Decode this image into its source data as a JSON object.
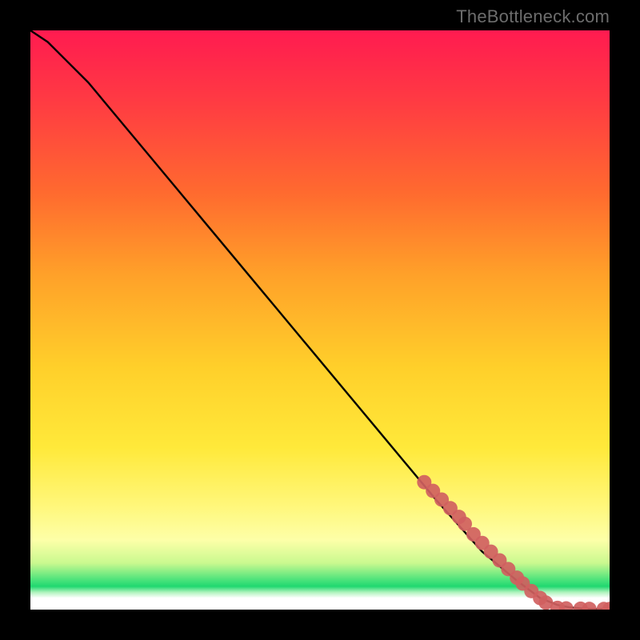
{
  "attribution": "TheBottleneck.com",
  "chart_data": {
    "type": "line",
    "title": "",
    "xlabel": "",
    "ylabel": "",
    "xlim": [
      0,
      100
    ],
    "ylim": [
      0,
      100
    ],
    "grid": false,
    "legend": false,
    "series": [
      {
        "name": "curve",
        "x": [
          0,
          3,
          6,
          10,
          15,
          20,
          30,
          40,
          50,
          60,
          70,
          78,
          84,
          88,
          91,
          93,
          95,
          97,
          100
        ],
        "y": [
          100,
          98,
          95,
          91,
          85,
          79,
          67,
          55,
          43,
          31,
          19,
          10,
          5,
          2,
          0.8,
          0.4,
          0.2,
          0.1,
          0.1
        ],
        "color": "#000000",
        "linewidth": 2.4
      }
    ],
    "markers": [
      {
        "name": "datapoints-on-curve",
        "color": "#d06060",
        "radius": 9,
        "points": [
          {
            "x": 68.0,
            "y": 22.0
          },
          {
            "x": 69.5,
            "y": 20.5
          },
          {
            "x": 71.0,
            "y": 19.0
          },
          {
            "x": 72.5,
            "y": 17.5
          },
          {
            "x": 74.0,
            "y": 16.0
          },
          {
            "x": 75.0,
            "y": 14.8
          },
          {
            "x": 76.5,
            "y": 13.0
          },
          {
            "x": 78.0,
            "y": 11.5
          },
          {
            "x": 79.5,
            "y": 10.0
          },
          {
            "x": 81.0,
            "y": 8.5
          },
          {
            "x": 82.5,
            "y": 7.0
          },
          {
            "x": 84.0,
            "y": 5.5
          },
          {
            "x": 85.0,
            "y": 4.5
          },
          {
            "x": 86.5,
            "y": 3.2
          },
          {
            "x": 88.0,
            "y": 2.0
          },
          {
            "x": 89.0,
            "y": 1.2
          }
        ]
      },
      {
        "name": "datapoints-bottom",
        "color": "#d06060",
        "radius": 9,
        "points": [
          {
            "x": 91.0,
            "y": 0.3
          },
          {
            "x": 92.5,
            "y": 0.2
          },
          {
            "x": 95.0,
            "y": 0.15
          },
          {
            "x": 96.5,
            "y": 0.12
          },
          {
            "x": 99.0,
            "y": 0.1
          },
          {
            "x": 100.0,
            "y": 0.1
          }
        ]
      }
    ]
  }
}
